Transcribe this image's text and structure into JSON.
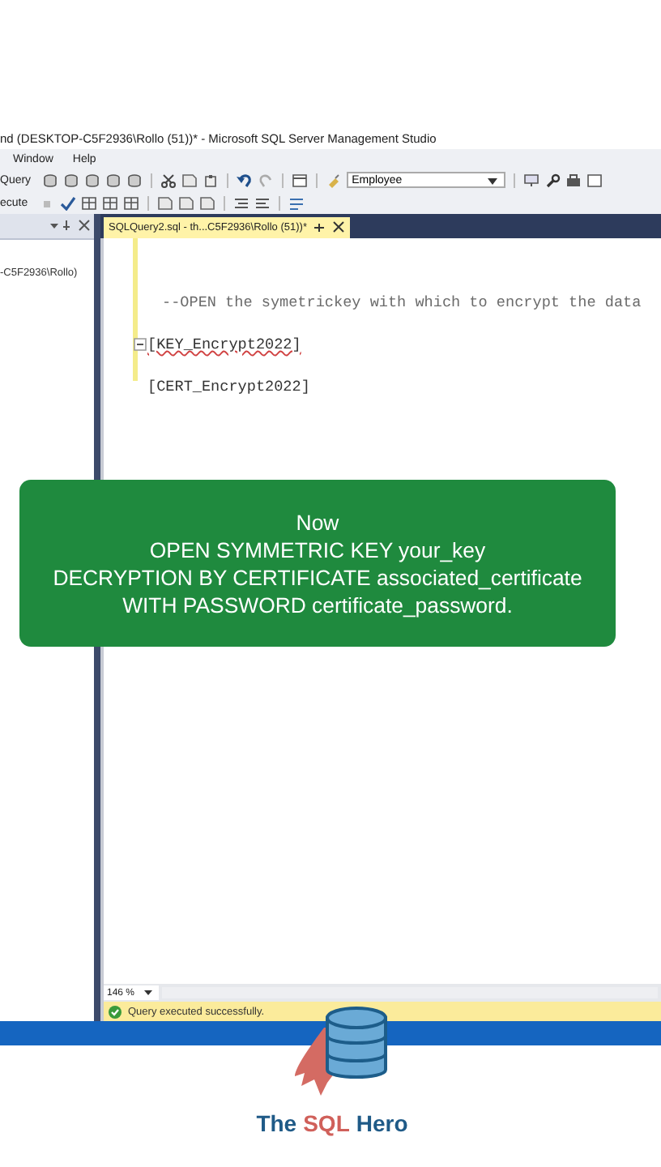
{
  "window": {
    "title": "nd (DESKTOP-C5F2936\\Rollo (51))* - Microsoft SQL Server Management Studio"
  },
  "menu": [
    {
      "label": "Window"
    },
    {
      "label": "Help"
    }
  ],
  "toolbar": {
    "query_label": "Query",
    "database": "Employee",
    "execute_label": "ecute"
  },
  "object_explorer": {
    "server": "-C5F2936\\Rollo)"
  },
  "tabs": [
    {
      "label": "SQLQuery2.sql - th...C5F2936\\Rollo (51))*",
      "selected": true
    }
  ],
  "editor": {
    "lines": [
      {
        "kind": "blank"
      },
      {
        "kind": "comment",
        "text": "--OPEN the symetrickey with which to encrypt the data"
      },
      {
        "kind": "code",
        "text": "[KEY_Encrypt2022]",
        "fold": true,
        "squiggle": true
      },
      {
        "kind": "code",
        "text": "[CERT_Encrypt2022]",
        "fold": false,
        "squiggle": false
      }
    ],
    "zoom": "146 %"
  },
  "status_bar": {
    "message": "Query executed successfully.",
    "ok": true
  },
  "caption": {
    "lines": [
      "Now",
      "OPEN SYMMETRIC KEY your_key",
      "DECRYPTION BY CERTIFICATE associated_certificate",
      "WITH PASSWORD certificate_password."
    ]
  },
  "brand": {
    "parts": [
      {
        "text": "The",
        "color": "#1f5a87"
      },
      {
        "text": "SQL",
        "color": "#d0605a"
      },
      {
        "text": "Hero",
        "color": "#1f5a87"
      }
    ]
  }
}
